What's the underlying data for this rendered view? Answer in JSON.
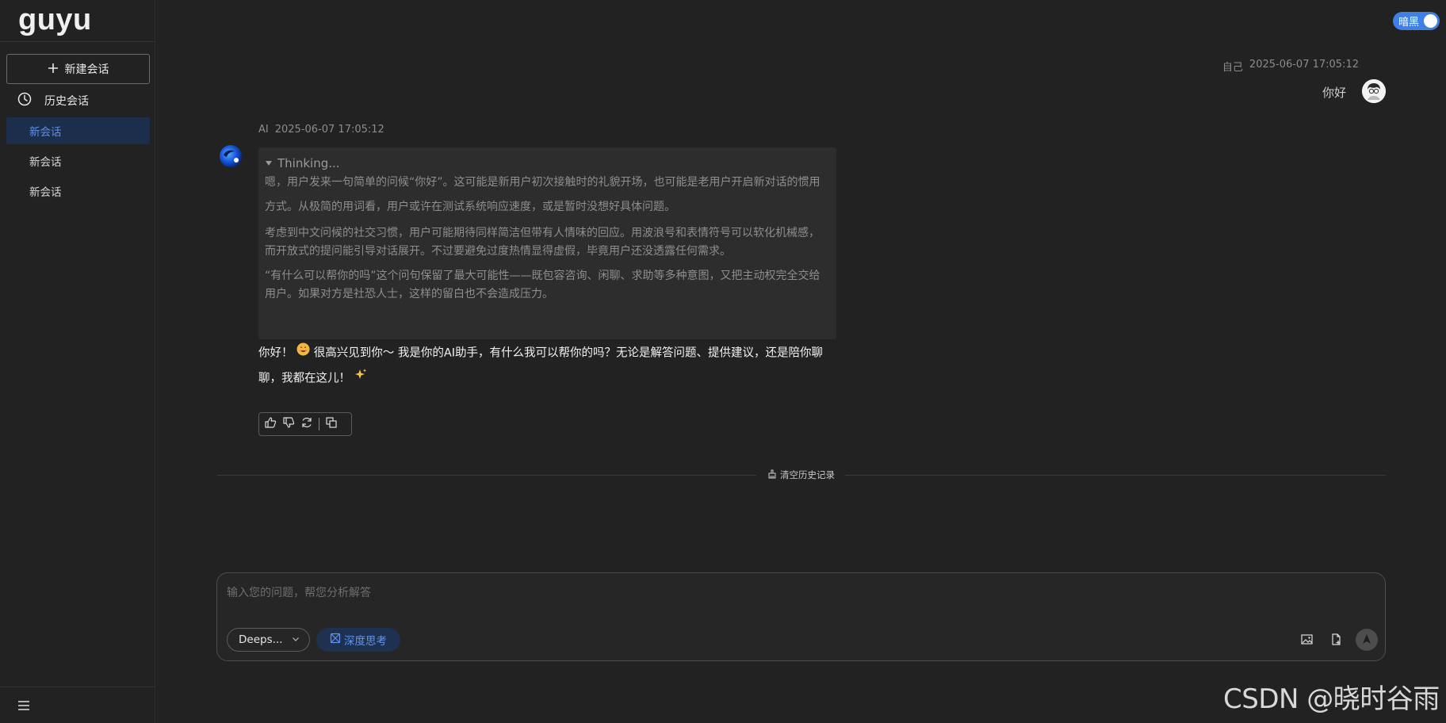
{
  "app": {
    "logo": "guyu"
  },
  "theme_toggle": {
    "label": "暗黑",
    "enabled": true
  },
  "sidebar": {
    "new_chat_label": "新建会话",
    "history_label": "历史会话",
    "conversations": [
      {
        "label": "新会话",
        "active": true
      },
      {
        "label": "新会话",
        "active": false
      },
      {
        "label": "新会话",
        "active": false
      }
    ]
  },
  "chat": {
    "user_message": {
      "sender": "自己",
      "time": "2025-06-07 17:05:12",
      "text": "你好"
    },
    "ai_message": {
      "sender": "AI",
      "time": "2025-06-07 17:05:12",
      "thinking_title": "Thinking...",
      "thinking_paragraphs": [
        "嗯，用户发来一句简单的问候“你好”。这可能是新用户初次接触时的礼貌开场，也可能是老用户开启新对话的惯用方式。从极简的用词看，用户或许在测试系统响应速度，或是暂时没想好具体问题。",
        "考虑到中文问候的社交习惯，用户可能期待同样简洁但带有人情味的回应。用波浪号和表情符号可以软化机械感，而开放式的提问能引导对话展开。不过要避免过度热情显得虚假，毕竟用户还没透露任何需求。",
        "“有什么可以帮你的吗”这个问句保留了最大可能性——既包容咨询、闲聊、求助等多种意图，又把主动权完全交给用户。如果对方是社恐人士，这样的留白也不会造成压力。"
      ],
      "answer_part1": "你好！",
      "answer_part2": " 很高兴见到你～ 我是你的AI助手，有什么我可以帮你的吗？无论是解答问题、提供建议，还是陪你聊聊，我都在这儿！",
      "icons": [
        "smile-emoji",
        "sparkles-emoji"
      ]
    },
    "actions": [
      "thumbs-up-icon",
      "thumbs-down-icon",
      "refresh-icon",
      "copy-icon"
    ],
    "clear_history_label": "清空历史记录"
  },
  "input": {
    "placeholder": "输入您的问题，帮您分析解答",
    "value": "",
    "model_label": "Deeps...",
    "deep_think_label": "深度思考"
  },
  "watermark": "CSDN @晓时谷雨",
  "colors": {
    "accent": "#3f7fe8",
    "background": "#222222",
    "active_item_bg": "#1c2e4c"
  }
}
